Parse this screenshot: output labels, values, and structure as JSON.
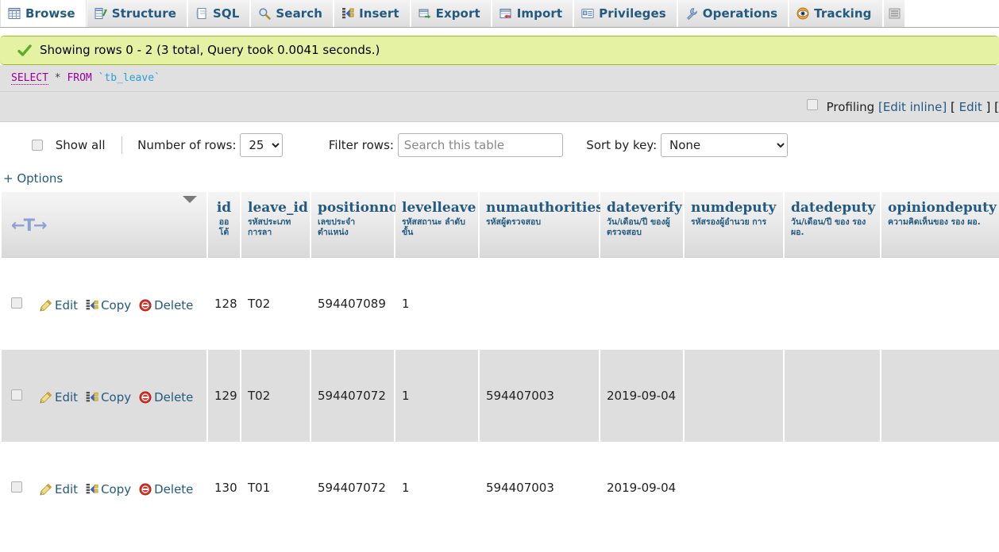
{
  "tabs": [
    {
      "label": "Browse",
      "icon": "browse-icon",
      "active": true
    },
    {
      "label": "Structure",
      "icon": "structure-icon",
      "active": false
    },
    {
      "label": "SQL",
      "icon": "sql-icon",
      "active": false
    },
    {
      "label": "Search",
      "icon": "search-icon",
      "active": false
    },
    {
      "label": "Insert",
      "icon": "insert-icon",
      "active": false
    },
    {
      "label": "Export",
      "icon": "export-icon",
      "active": false
    },
    {
      "label": "Import",
      "icon": "import-icon",
      "active": false
    },
    {
      "label": "Privileges",
      "icon": "privileges-icon",
      "active": false
    },
    {
      "label": "Operations",
      "icon": "operations-icon",
      "active": false
    },
    {
      "label": "Tracking",
      "icon": "tracking-icon",
      "active": false
    }
  ],
  "status": {
    "icon": "success-check-icon",
    "message": "Showing rows 0 - 2 (3 total, Query took 0.0041 seconds.)"
  },
  "query": {
    "select": "SELECT",
    "star": "*",
    "from": "FROM",
    "table": "`tb_leave`"
  },
  "profiling": {
    "label": "Profiling",
    "edit_inline": "[Edit inline]",
    "bracket_open": "[",
    "edit": "Edit",
    "bracket_close": "]",
    "trailing_bracket": "["
  },
  "options": {
    "show_all_label": "Show all",
    "number_of_rows_label": "Number of rows:",
    "rows_value": "25",
    "rows_options": [
      "25"
    ],
    "filter_rows_label": "Filter rows:",
    "filter_placeholder": "Search this table",
    "filter_value": "",
    "sort_by_key_label": "Sort by key:",
    "sort_by_key_value": "None",
    "sort_by_key_options": [
      "None"
    ],
    "options_link": "+ Options"
  },
  "table": {
    "action_header": {
      "sort_arrow": "sort-dropdown-arrow-icon",
      "t_arrow": "←T→"
    },
    "row_actions": {
      "edit": "Edit",
      "copy": "Copy",
      "delete": "Delete"
    },
    "columns": [
      {
        "name": "id",
        "comment": "ออโต้"
      },
      {
        "name": "leave_id",
        "comment": "รหัสประเภท การลา"
      },
      {
        "name": "positionno",
        "comment": "เลขประจำ ตำแหน่ง"
      },
      {
        "name": "levelleave",
        "comment": "รหัสสถานะ ลำดับขั้น"
      },
      {
        "name": "numauthorities",
        "comment": "รหัสผู้ตรวจสอบ"
      },
      {
        "name": "dateverify",
        "comment": "วัน/เดือน/ปี ของผู้ตรวจสอบ"
      },
      {
        "name": "numdeputy",
        "comment": "รหัสรองผู้อำนวย การ"
      },
      {
        "name": "datedeputy",
        "comment": "วัน/เดือน/ปี ของ รองผอ."
      },
      {
        "name": "opiniondeputy",
        "comment": "ความคิดเห็นของ รอง ผอ."
      }
    ],
    "rows": [
      {
        "id": "128",
        "leave_id": "T02",
        "positionno": "594407089",
        "levelleave": "1",
        "numauthorities": "",
        "dateverify": "",
        "numdeputy": "",
        "datedeputy": "",
        "opiniondeputy": ""
      },
      {
        "id": "129",
        "leave_id": "T02",
        "positionno": "594407072",
        "levelleave": "1",
        "numauthorities": "594407003",
        "dateverify": "2019-09-04",
        "numdeputy": "",
        "datedeputy": "",
        "opiniondeputy": ""
      },
      {
        "id": "130",
        "leave_id": "T01",
        "positionno": "594407072",
        "levelleave": "1",
        "numauthorities": "594407003",
        "dateverify": "2019-09-04",
        "numdeputy": "",
        "datedeputy": "",
        "opiniondeputy": ""
      }
    ]
  },
  "colors": {
    "link": "#235a81",
    "success_bg": "#e5f2a4",
    "success_border": "#a2bb2a",
    "odd_row_bg": "#dedede",
    "query_bg": "#e0e0e0",
    "keyword": "#990099",
    "table_token": "#2a9fd6",
    "t_arrow": "#8e9fd4"
  }
}
